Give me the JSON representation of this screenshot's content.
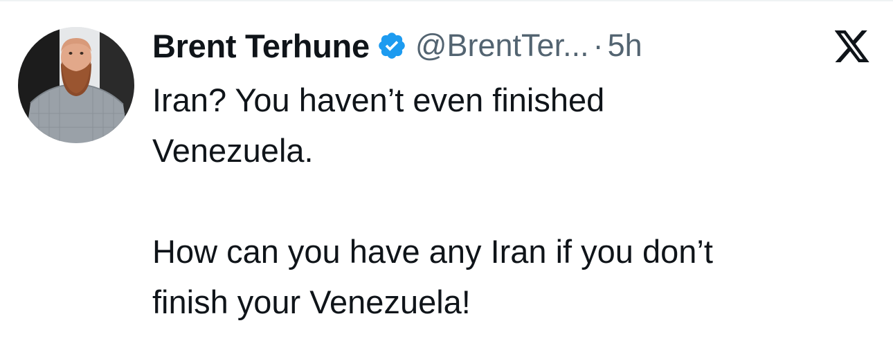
{
  "tweet": {
    "display_name": "Brent Terhune",
    "handle": "@BrentTer...",
    "separator": "·",
    "time": "5h",
    "text": "Iran? You haven’t even finished\nVenezuela.\n\nHow can you have any Iran if you don’t\nfinish your Venezuela!"
  },
  "icons": {
    "verified": "verified-badge-icon",
    "platform": "x-logo-icon",
    "avatar": "avatar-photo"
  },
  "colors": {
    "verified_blue": "#1d9bf0",
    "text_primary": "#0f1419",
    "text_secondary": "#536471"
  }
}
